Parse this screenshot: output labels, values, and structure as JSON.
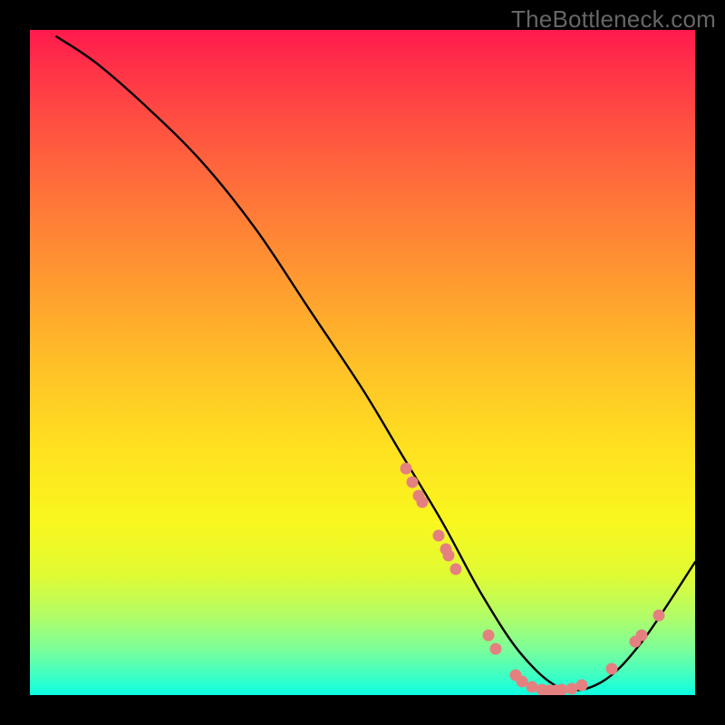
{
  "watermark": "TheBottleneck.com",
  "chart_data": {
    "type": "line",
    "title": "",
    "xlabel": "",
    "ylabel": "",
    "xlim": [
      0,
      100
    ],
    "ylim": [
      0,
      100
    ],
    "series": [
      {
        "name": "bottleneck-curve",
        "x": [
          4,
          10,
          18,
          26,
          34,
          42,
          50,
          56,
          62,
          68,
          74,
          80,
          86,
          92,
          100
        ],
        "y": [
          99,
          95,
          88,
          80,
          70,
          58,
          46,
          36,
          26,
          15,
          6,
          1,
          2,
          8,
          20
        ]
      }
    ],
    "markers": {
      "name": "highlighted-points",
      "color": "#e58080",
      "points": [
        {
          "x": 56.5,
          "y": 34
        },
        {
          "x": 57.5,
          "y": 32
        },
        {
          "x": 58.5,
          "y": 30
        },
        {
          "x": 59.0,
          "y": 29
        },
        {
          "x": 61.5,
          "y": 24
        },
        {
          "x": 62.5,
          "y": 22
        },
        {
          "x": 63.0,
          "y": 21
        },
        {
          "x": 64.0,
          "y": 19
        },
        {
          "x": 69.0,
          "y": 9
        },
        {
          "x": 70.0,
          "y": 7
        },
        {
          "x": 73.0,
          "y": 3
        },
        {
          "x": 74.0,
          "y": 2
        },
        {
          "x": 75.5,
          "y": 1.2
        },
        {
          "x": 77.0,
          "y": 0.8
        },
        {
          "x": 78.0,
          "y": 0.7
        },
        {
          "x": 79.0,
          "y": 0.7
        },
        {
          "x": 80.0,
          "y": 0.8
        },
        {
          "x": 81.5,
          "y": 1.0
        },
        {
          "x": 83.0,
          "y": 1.5
        },
        {
          "x": 87.5,
          "y": 4
        },
        {
          "x": 91.0,
          "y": 8
        },
        {
          "x": 92.0,
          "y": 9
        },
        {
          "x": 94.5,
          "y": 12
        }
      ]
    }
  }
}
